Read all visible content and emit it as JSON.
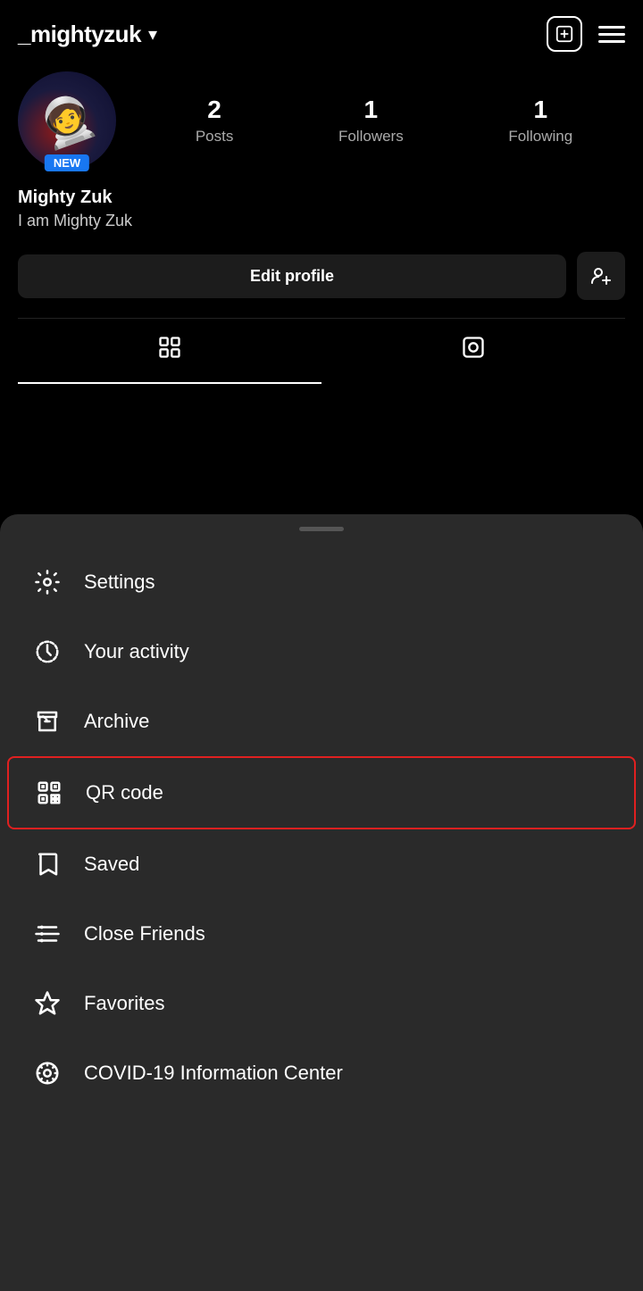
{
  "header": {
    "username": "_mightyzuk",
    "chevron": "▾",
    "add_icon_label": "+",
    "hamburger_label": "menu"
  },
  "profile": {
    "display_name": "Mighty Zuk",
    "bio": "I am Mighty Zuk",
    "new_badge": "NEW",
    "avatar_emoji": "🧑‍🚀",
    "stats": {
      "posts": {
        "count": "2",
        "label": "Posts"
      },
      "followers": {
        "count": "1",
        "label": "Followers"
      },
      "following": {
        "count": "1",
        "label": "Following"
      }
    }
  },
  "buttons": {
    "edit_profile": "Edit profile",
    "add_friend_icon": "👤+"
  },
  "tabs": [
    {
      "id": "grid",
      "label": "Grid",
      "active": true
    },
    {
      "id": "tagged",
      "label": "Tagged",
      "active": false
    }
  ],
  "drawer": {
    "handle_label": "drag handle",
    "menu_items": [
      {
        "id": "settings",
        "label": "Settings",
        "icon": "settings",
        "highlighted": false
      },
      {
        "id": "your-activity",
        "label": "Your activity",
        "icon": "activity",
        "highlighted": false
      },
      {
        "id": "archive",
        "label": "Archive",
        "icon": "archive",
        "highlighted": false
      },
      {
        "id": "qr-code",
        "label": "QR code",
        "icon": "qr",
        "highlighted": true
      },
      {
        "id": "saved",
        "label": "Saved",
        "icon": "bookmark",
        "highlighted": false
      },
      {
        "id": "close-friends",
        "label": "Close Friends",
        "icon": "close-friends",
        "highlighted": false
      },
      {
        "id": "favorites",
        "label": "Favorites",
        "icon": "star",
        "highlighted": false
      },
      {
        "id": "covid",
        "label": "COVID-19 Information Center",
        "icon": "covid",
        "highlighted": false
      }
    ]
  },
  "colors": {
    "bg": "#000000",
    "drawer_bg": "#2a2a2a",
    "highlight_border": "#e02020",
    "accent_blue": "#1877f2",
    "text_primary": "#ffffff",
    "text_secondary": "#aaaaaa"
  }
}
